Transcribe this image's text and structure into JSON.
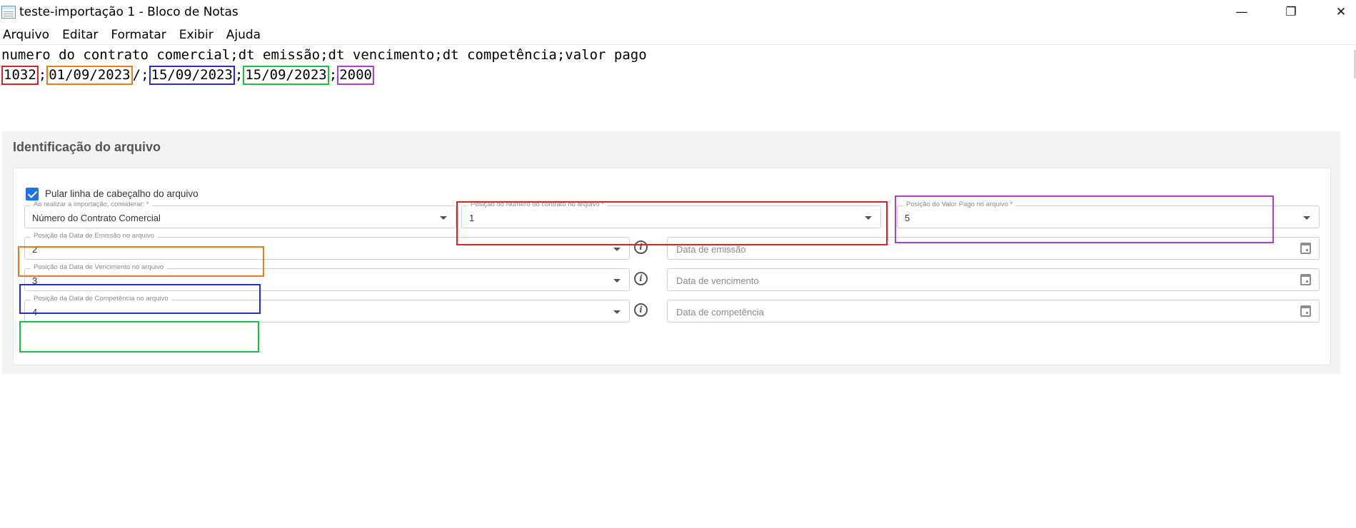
{
  "window": {
    "title": "teste-importação 1 - Bloco de Notas",
    "minimize": "—",
    "maximize": "❐",
    "close": "✕"
  },
  "menu": [
    "Arquivo",
    "Editar",
    "Formatar",
    "Exibir",
    "Ajuda"
  ],
  "editor": {
    "header_line": "numero do contrato comercial;dt emissão;dt vencimento;dt competência;valor pago",
    "row": {
      "contrato": "1032",
      "emissao": "01/09/2023",
      "vencimento": "15/09/2023",
      "competencia": "15/09/2023",
      "valor": "2000",
      "sep": ";",
      "extra_slash": "/"
    }
  },
  "form": {
    "section_title": "Identificação do arquivo",
    "skip_header_label": "Pular linha de cabeçalho do arquivo",
    "skip_header_checked": true,
    "consider": {
      "label": "Ao realizar a importação, considerar: *",
      "value": "Número do Contrato Comercial"
    },
    "pos_contrato": {
      "label": "Posição do Número do contrato no arquivo *",
      "value": "1"
    },
    "pos_valor": {
      "label": "Posição do Valor Pago no arquivo *",
      "value": "5"
    },
    "pos_emissao": {
      "label": "Posição da Data de Emissão no arquivo",
      "value": "2"
    },
    "pos_vencimento": {
      "label": "Posição da Data de Vencimento no arquivo",
      "value": "3"
    },
    "pos_competencia": {
      "label": "Posição da Data de Competência no arquivo",
      "value": "4"
    },
    "date_emissao_placeholder": "Data de emissão",
    "date_vencimento_placeholder": "Data de vencimento",
    "date_competencia_placeholder": "Data de competência",
    "info_glyph": "i"
  },
  "colors": {
    "red": "#e02020",
    "orange": "#f07a17",
    "blue": "#2a2ad0",
    "green": "#19c23a",
    "purple": "#b43cd6",
    "accent": "#1a73e8"
  }
}
